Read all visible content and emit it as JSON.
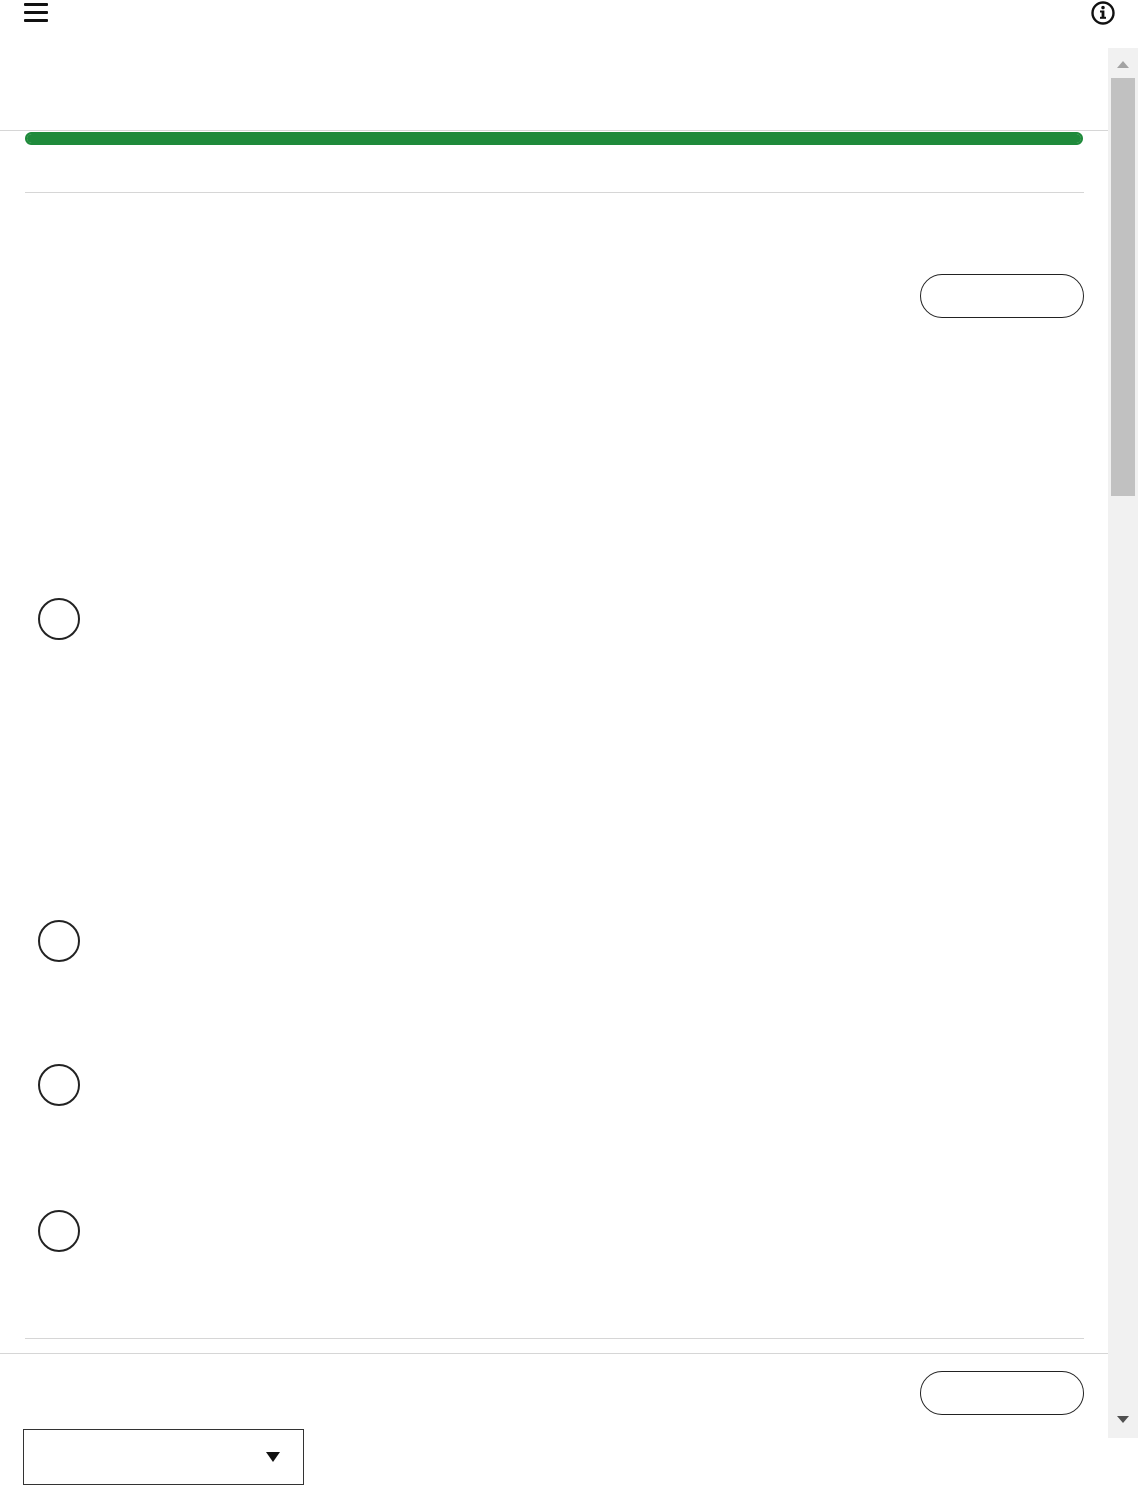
{
  "header": {
    "menu_icon": "hamburger-menu-icon",
    "info_icon": "info-circle-icon"
  },
  "progress": {
    "fraction": 1.0,
    "color": "#1f8a3b"
  },
  "question": {
    "top_button_label": "",
    "options": [
      {
        "label": ""
      },
      {
        "label": ""
      },
      {
        "label": ""
      },
      {
        "label": ""
      }
    ]
  },
  "footer": {
    "bottom_button_label": "",
    "dropdown_value": ""
  },
  "colors": {
    "accent": "#1f8a3b",
    "scrollbar_track": "#f1f1f1",
    "scrollbar_thumb": "#c1c1c1"
  }
}
